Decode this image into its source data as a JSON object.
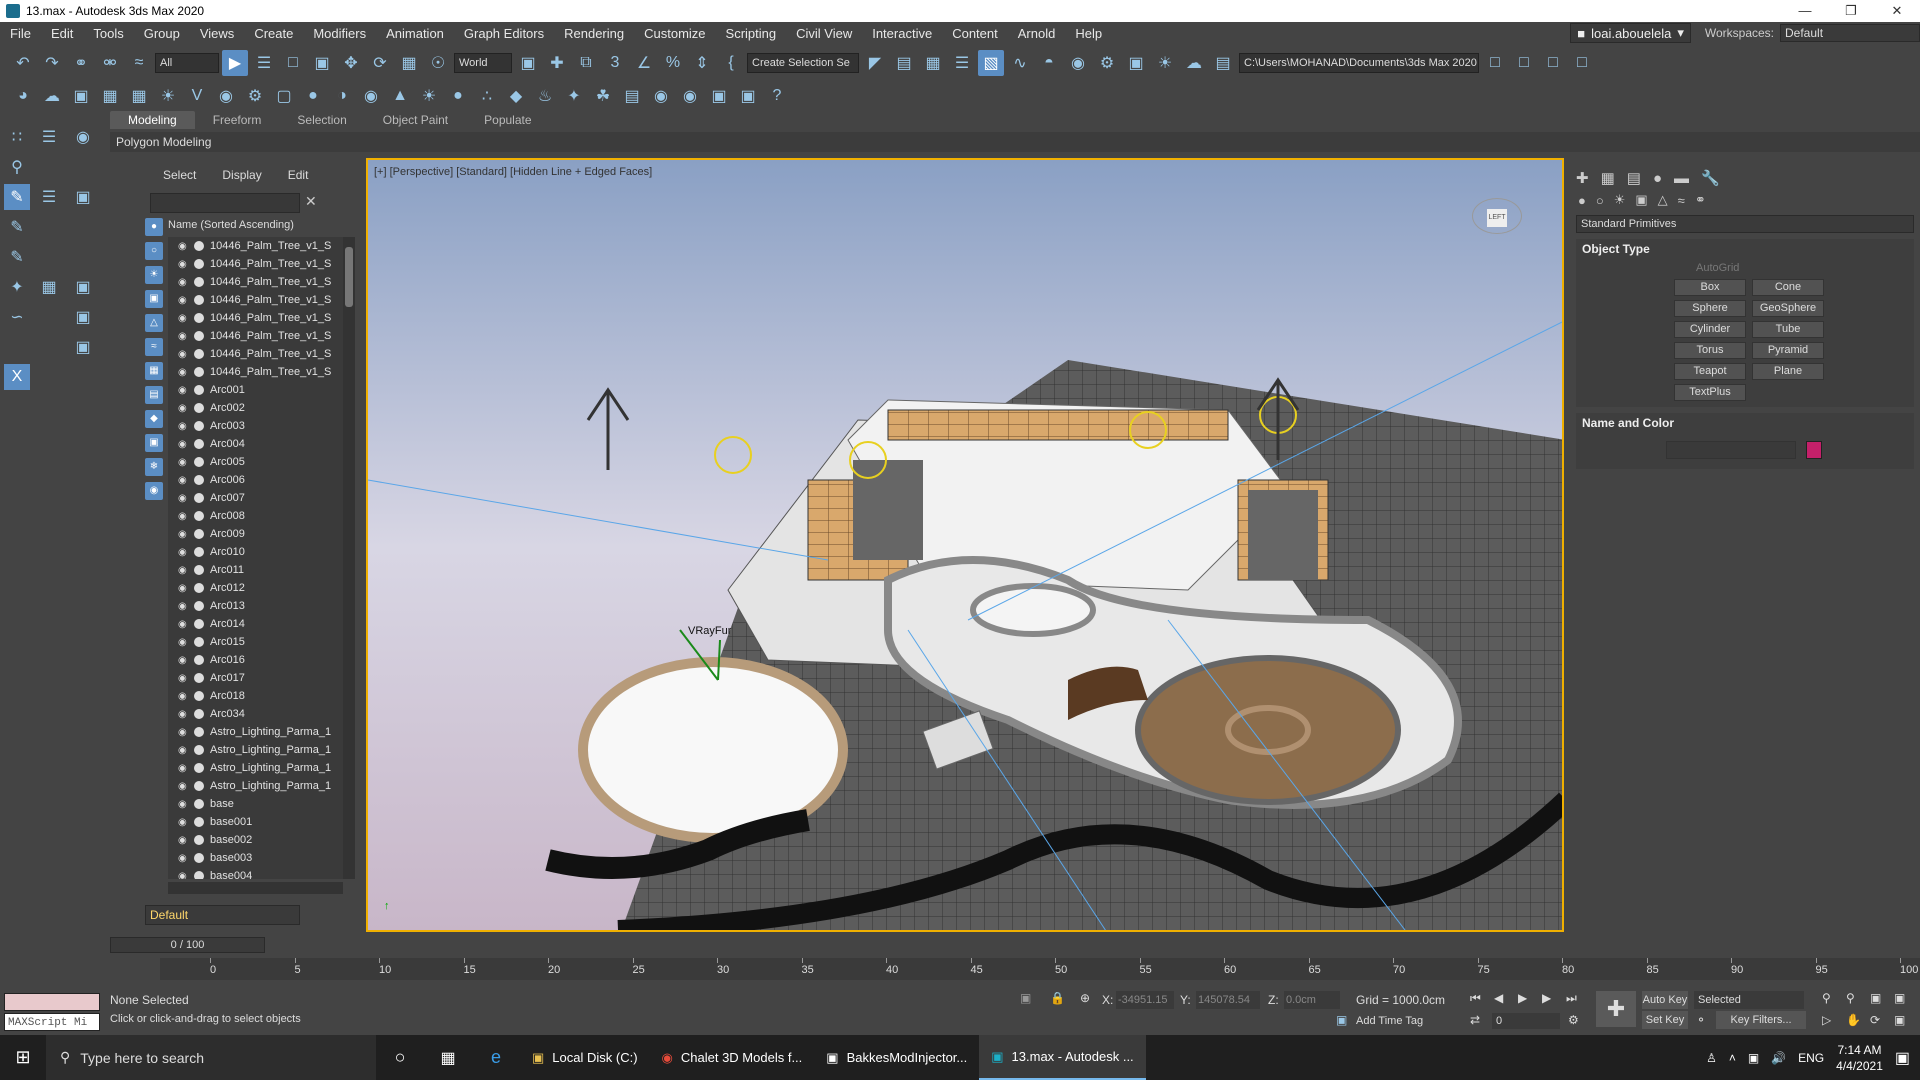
{
  "window": {
    "title": "13.max - Autodesk 3ds Max 2020"
  },
  "menu": [
    "File",
    "Edit",
    "Tools",
    "Group",
    "Views",
    "Create",
    "Modifiers",
    "Animation",
    "Graph Editors",
    "Rendering",
    "Customize",
    "Scripting",
    "Civil View",
    "Interactive",
    "Content",
    "Arnold",
    "Help"
  ],
  "user": {
    "name": "loai.abouelela"
  },
  "workspace": {
    "label": "Workspaces:",
    "value": "Default"
  },
  "toolbar": {
    "filter": "All",
    "coord": "World",
    "selection_set": "Create Selection Se",
    "path": "C:\\Users\\MOHANAD\\Documents\\3ds Max 2020"
  },
  "ribbon": {
    "tabs": [
      "Modeling",
      "Freeform",
      "Selection",
      "Object Paint",
      "Populate"
    ],
    "active": "Modeling",
    "sub": "Polygon Modeling"
  },
  "explorer": {
    "tabs": [
      "Select",
      "Display",
      "Edit"
    ],
    "header": "Name (Sorted Ascending)",
    "items": [
      "10446_Palm_Tree_v1_S",
      "10446_Palm_Tree_v1_S",
      "10446_Palm_Tree_v1_S",
      "10446_Palm_Tree_v1_S",
      "10446_Palm_Tree_v1_S",
      "10446_Palm_Tree_v1_S",
      "10446_Palm_Tree_v1_S",
      "10446_Palm_Tree_v1_S",
      "Arc001",
      "Arc002",
      "Arc003",
      "Arc004",
      "Arc005",
      "Arc006",
      "Arc007",
      "Arc008",
      "Arc009",
      "Arc010",
      "Arc011",
      "Arc012",
      "Arc013",
      "Arc014",
      "Arc015",
      "Arc016",
      "Arc017",
      "Arc018",
      "Arc034",
      "Astro_Lighting_Parma_1",
      "Astro_Lighting_Parma_1",
      "Astro_Lighting_Parma_1",
      "Astro_Lighting_Parma_1",
      "base",
      "base001",
      "base002",
      "base003",
      "base004"
    ],
    "layer": "Default"
  },
  "viewport": {
    "label": "[+] [Perspective] [Standard] [Hidden Line + Edged Faces]",
    "vray_label": "VRayFur",
    "cube_label": "LEFT"
  },
  "command_panel": {
    "dropdown": "Standard Primitives",
    "object_type_title": "Object Type",
    "autogrid": "AutoGrid",
    "buttons": [
      "Box",
      "Cone",
      "Sphere",
      "GeoSphere",
      "Cylinder",
      "Tube",
      "Torus",
      "Pyramid",
      "Teapot",
      "Plane",
      "TextPlus"
    ],
    "name_color_title": "Name and Color",
    "color": "#c4206a"
  },
  "timeline": {
    "slider": "0 / 100",
    "ticks": [
      "0",
      "5",
      "10",
      "15",
      "20",
      "25",
      "30",
      "35",
      "40",
      "45",
      "50",
      "55",
      "60",
      "65",
      "70",
      "75",
      "80",
      "85",
      "90",
      "95",
      "100"
    ]
  },
  "status": {
    "selected": "None Selected",
    "prompt": "Click or click-and-drag to select objects",
    "x_label": "X:",
    "x": "-34951.15",
    "y_label": "Y:",
    "y": "145078.54",
    "z_label": "Z:",
    "z": "0.0cm",
    "grid": "Grid = 1000.0cm",
    "add_time_tag": "Add Time Tag",
    "auto_key": "Auto Key",
    "set_key": "Set Key",
    "key_mode": "Selected",
    "key_filters": "Key Filters...",
    "frame": "0",
    "maxscript": "MAXScript Mi"
  },
  "taskbar": {
    "search_placeholder": "Type here to search",
    "apps": [
      "Local Disk (C:)",
      "Chalet 3D Models f...",
      "BakkesModInjector...",
      "13.max - Autodesk ..."
    ],
    "lang": "ENG",
    "time": "7:14 AM",
    "date": "4/4/2021"
  }
}
